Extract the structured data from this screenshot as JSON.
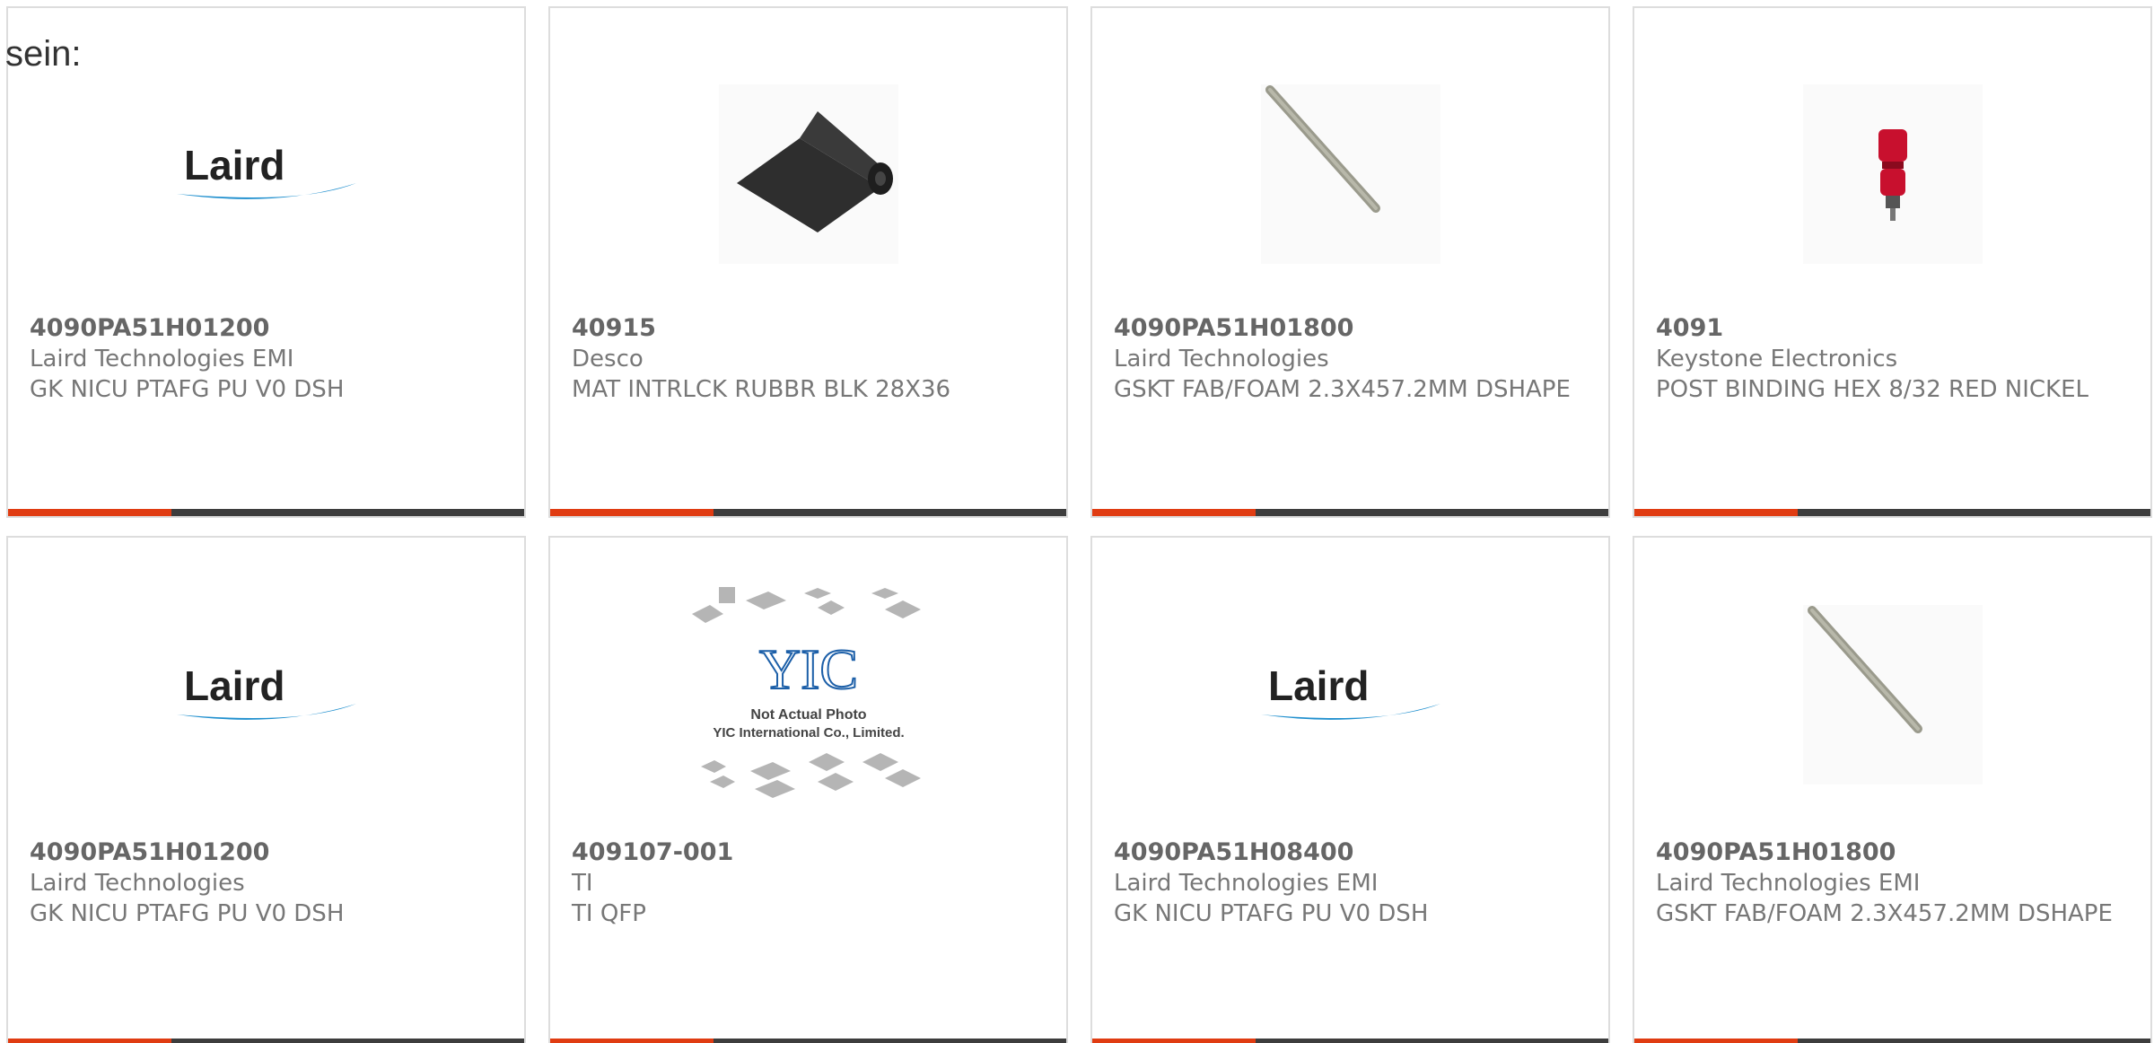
{
  "intro_text": "sein:",
  "colors": {
    "accent": "#e03c12",
    "bar": "#3d3d3d",
    "border": "#dddddd",
    "laird_text": "#222222",
    "laird_swoosh": "#1f8fce",
    "stopper_red": "#c8102e"
  },
  "products": [
    {
      "part_number": "4090PA51H01200",
      "manufacturer": "Laird Technologies EMI",
      "description": "GK NICU PTAFG PU V0 DSH",
      "image": "laird-logo"
    },
    {
      "part_number": "40915",
      "manufacturer": "Desco",
      "description": "MAT INTRLCK RUBBR BLK 28X36",
      "image": "rubber-mat-roll"
    },
    {
      "part_number": "4090PA51H01800",
      "manufacturer": "Laird Technologies",
      "description": "GSKT FAB/FOAM 2.3X457.2MM DSHAPE",
      "image": "gasket-rod"
    },
    {
      "part_number": "4091",
      "manufacturer": "Keystone Electronics",
      "description": "POST BINDING HEX 8/32 RED NICKEL",
      "image": "binding-post-red"
    },
    {
      "part_number": "4090PA51H01200",
      "manufacturer": "Laird Technologies",
      "description": "GK NICU PTAFG PU V0 DSH",
      "image": "laird-logo"
    },
    {
      "part_number": "409107-001",
      "manufacturer": "TI",
      "description": "TI QFP",
      "image": "yic-placeholder"
    },
    {
      "part_number": "4090PA51H08400",
      "manufacturer": "Laird Technologies EMI",
      "description": "GK NICU PTAFG PU V0 DSH",
      "image": "laird-logo"
    },
    {
      "part_number": "4090PA51H01800",
      "manufacturer": "Laird Technologies EMI",
      "description": "GSKT FAB/FOAM 2.3X457.2MM DSHAPE",
      "image": "gasket-rod"
    }
  ],
  "logo_text": {
    "laird": "Laird",
    "yic_brand": "YIC",
    "yic_line1": "Not Actual Photo",
    "yic_line2": "YIC International Co., Limited."
  }
}
